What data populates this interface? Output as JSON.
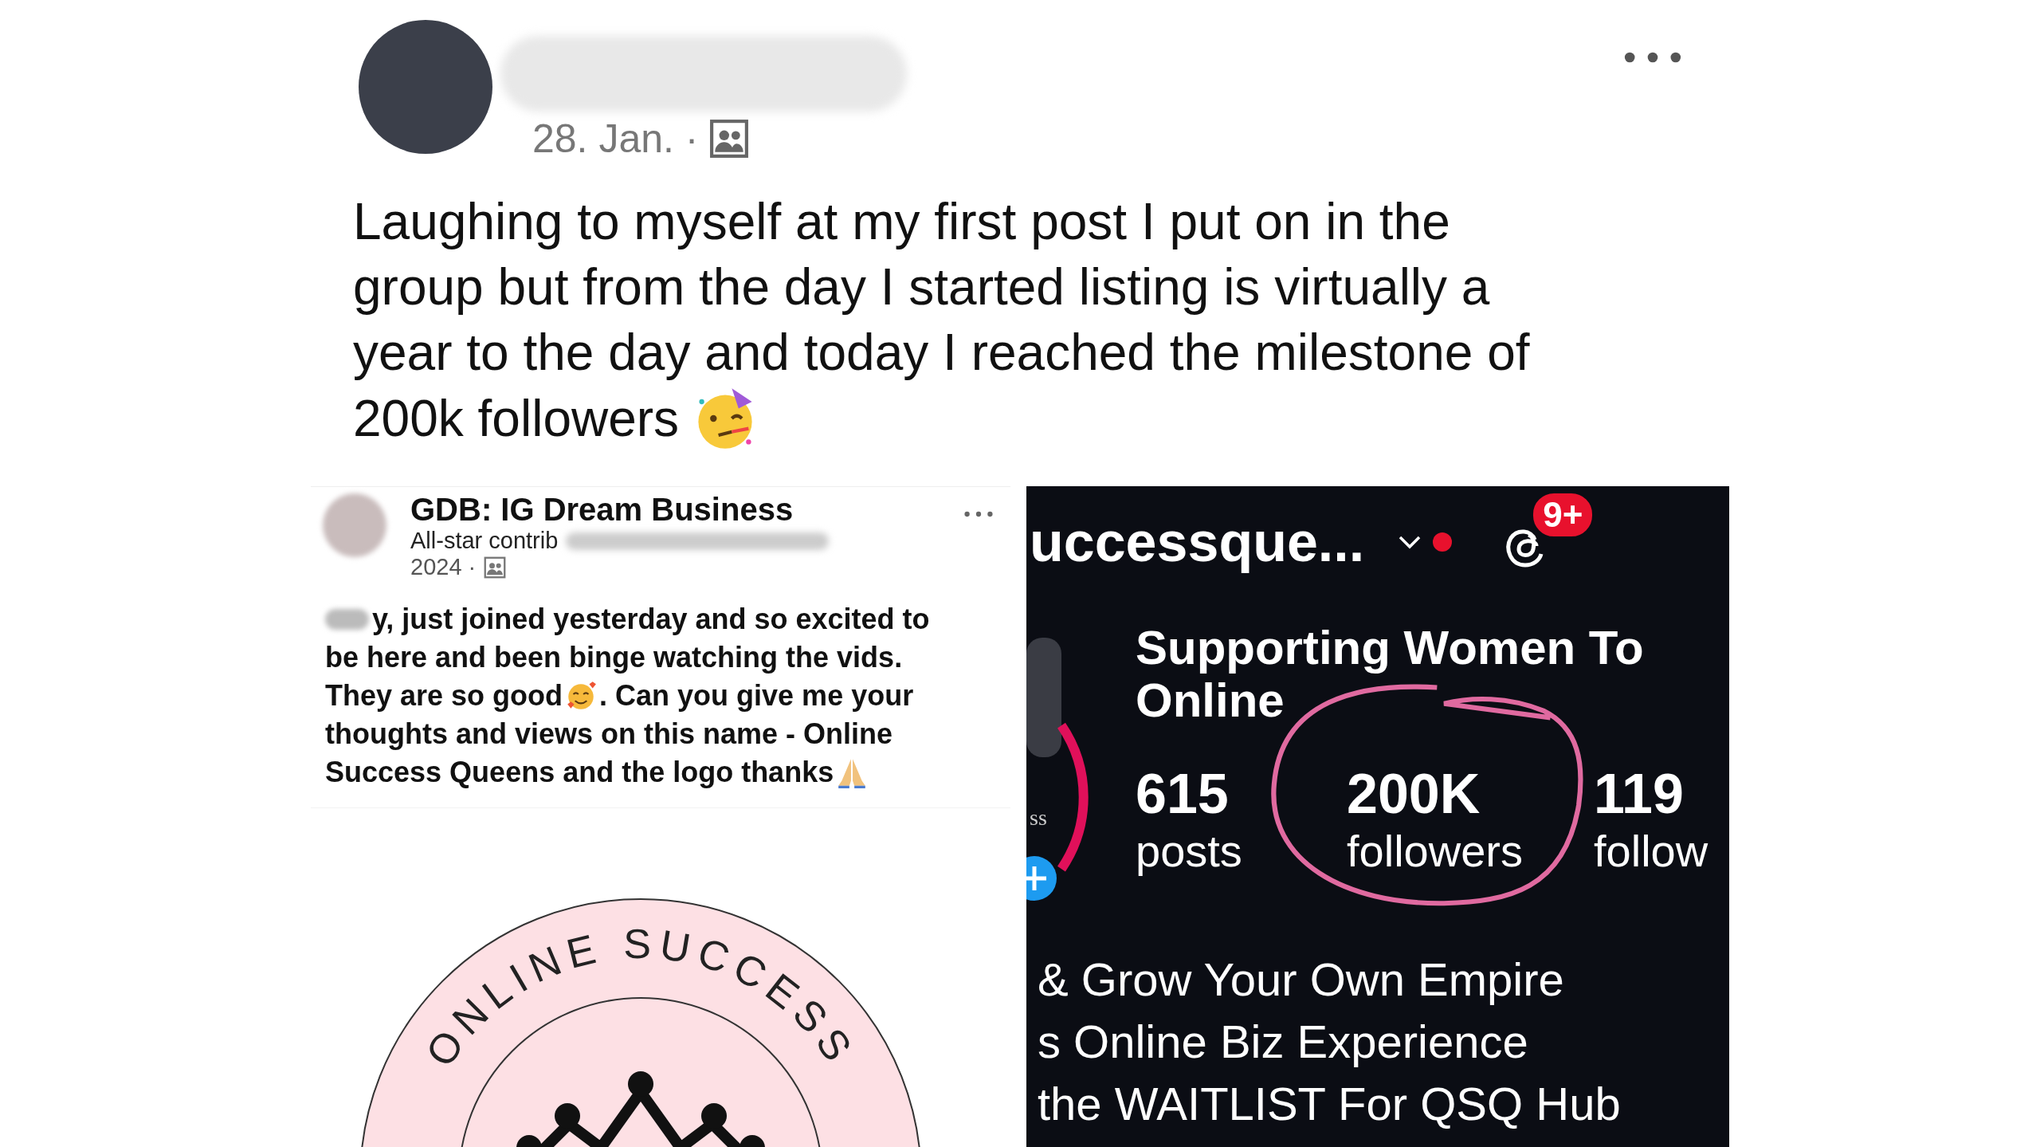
{
  "post": {
    "date": "28. Jan. ·",
    "lines": [
      "Laughing to myself at my first post I put on in the",
      "group but from the day I started listing is virtually a",
      "year to the day and today I reached the milestone of",
      "200k followers"
    ]
  },
  "shared_post": {
    "group": "GDB: IG Dream Business",
    "badge": "All-star contrib",
    "year": "2024 ·",
    "body_lines": [
      [
        {
          "kind": "text",
          "text": "y, just joined yesterday and so excited to"
        }
      ],
      [
        {
          "kind": "text",
          "text": "be here and been binge watching the vids."
        }
      ],
      [
        {
          "kind": "text",
          "text": "They are so good"
        },
        {
          "kind": "emoji"
        },
        {
          "kind": "text",
          "text": ". Can you give me your"
        }
      ],
      [
        {
          "kind": "text",
          "text": "thoughts and views on this name - Online"
        }
      ],
      [
        {
          "kind": "text",
          "text": "Success Queens and the logo thanks"
        },
        {
          "kind": "emoji"
        }
      ]
    ],
    "logo_text": "ONLINE SUCCESS"
  },
  "profile": {
    "username": "uccessque...",
    "notification_count": "9+",
    "avatar_text": "ss",
    "bio_lines": [
      "Supporting Women To",
      "Online"
    ],
    "stats": [
      {
        "value": "615",
        "label": "posts",
        "circled": false
      },
      {
        "value": "200K",
        "label": "followers",
        "circled": true
      },
      {
        "value": "119",
        "label": "follow",
        "circled": false
      }
    ],
    "description_lines": [
      "& Grow Your Own Empire",
      "s Online Biz Experience",
      "the WAITLIST For QSQ Hub"
    ]
  }
}
